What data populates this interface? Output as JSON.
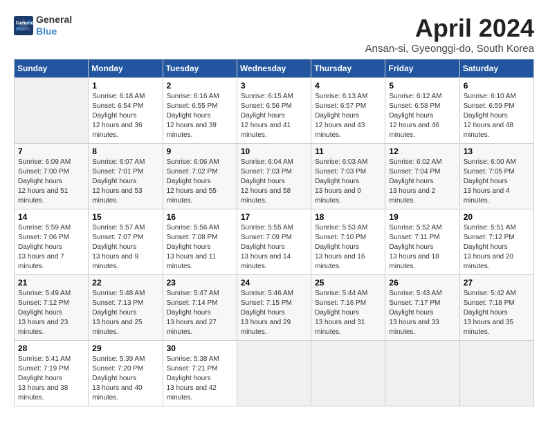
{
  "header": {
    "logo_line1": "General",
    "logo_line2": "Blue",
    "title": "April 2024",
    "subtitle": "Ansan-si, Gyeonggi-do, South Korea"
  },
  "weekdays": [
    "Sunday",
    "Monday",
    "Tuesday",
    "Wednesday",
    "Thursday",
    "Friday",
    "Saturday"
  ],
  "weeks": [
    [
      {
        "day": "",
        "empty": true
      },
      {
        "day": "1",
        "sunrise": "6:18 AM",
        "sunset": "6:54 PM",
        "daylight": "12 hours and 36 minutes."
      },
      {
        "day": "2",
        "sunrise": "6:16 AM",
        "sunset": "6:55 PM",
        "daylight": "12 hours and 39 minutes."
      },
      {
        "day": "3",
        "sunrise": "6:15 AM",
        "sunset": "6:56 PM",
        "daylight": "12 hours and 41 minutes."
      },
      {
        "day": "4",
        "sunrise": "6:13 AM",
        "sunset": "6:57 PM",
        "daylight": "12 hours and 43 minutes."
      },
      {
        "day": "5",
        "sunrise": "6:12 AM",
        "sunset": "6:58 PM",
        "daylight": "12 hours and 46 minutes."
      },
      {
        "day": "6",
        "sunrise": "6:10 AM",
        "sunset": "6:59 PM",
        "daylight": "12 hours and 48 minutes."
      }
    ],
    [
      {
        "day": "7",
        "sunrise": "6:09 AM",
        "sunset": "7:00 PM",
        "daylight": "12 hours and 51 minutes."
      },
      {
        "day": "8",
        "sunrise": "6:07 AM",
        "sunset": "7:01 PM",
        "daylight": "12 hours and 53 minutes."
      },
      {
        "day": "9",
        "sunrise": "6:06 AM",
        "sunset": "7:02 PM",
        "daylight": "12 hours and 55 minutes."
      },
      {
        "day": "10",
        "sunrise": "6:04 AM",
        "sunset": "7:03 PM",
        "daylight": "12 hours and 58 minutes."
      },
      {
        "day": "11",
        "sunrise": "6:03 AM",
        "sunset": "7:03 PM",
        "daylight": "13 hours and 0 minutes."
      },
      {
        "day": "12",
        "sunrise": "6:02 AM",
        "sunset": "7:04 PM",
        "daylight": "13 hours and 2 minutes."
      },
      {
        "day": "13",
        "sunrise": "6:00 AM",
        "sunset": "7:05 PM",
        "daylight": "13 hours and 4 minutes."
      }
    ],
    [
      {
        "day": "14",
        "sunrise": "5:59 AM",
        "sunset": "7:06 PM",
        "daylight": "13 hours and 7 minutes."
      },
      {
        "day": "15",
        "sunrise": "5:57 AM",
        "sunset": "7:07 PM",
        "daylight": "13 hours and 9 minutes."
      },
      {
        "day": "16",
        "sunrise": "5:56 AM",
        "sunset": "7:08 PM",
        "daylight": "13 hours and 11 minutes."
      },
      {
        "day": "17",
        "sunrise": "5:55 AM",
        "sunset": "7:09 PM",
        "daylight": "13 hours and 14 minutes."
      },
      {
        "day": "18",
        "sunrise": "5:53 AM",
        "sunset": "7:10 PM",
        "daylight": "13 hours and 16 minutes."
      },
      {
        "day": "19",
        "sunrise": "5:52 AM",
        "sunset": "7:11 PM",
        "daylight": "13 hours and 18 minutes."
      },
      {
        "day": "20",
        "sunrise": "5:51 AM",
        "sunset": "7:12 PM",
        "daylight": "13 hours and 20 minutes."
      }
    ],
    [
      {
        "day": "21",
        "sunrise": "5:49 AM",
        "sunset": "7:12 PM",
        "daylight": "13 hours and 23 minutes."
      },
      {
        "day": "22",
        "sunrise": "5:48 AM",
        "sunset": "7:13 PM",
        "daylight": "13 hours and 25 minutes."
      },
      {
        "day": "23",
        "sunrise": "5:47 AM",
        "sunset": "7:14 PM",
        "daylight": "13 hours and 27 minutes."
      },
      {
        "day": "24",
        "sunrise": "5:46 AM",
        "sunset": "7:15 PM",
        "daylight": "13 hours and 29 minutes."
      },
      {
        "day": "25",
        "sunrise": "5:44 AM",
        "sunset": "7:16 PM",
        "daylight": "13 hours and 31 minutes."
      },
      {
        "day": "26",
        "sunrise": "5:43 AM",
        "sunset": "7:17 PM",
        "daylight": "13 hours and 33 minutes."
      },
      {
        "day": "27",
        "sunrise": "5:42 AM",
        "sunset": "7:18 PM",
        "daylight": "13 hours and 35 minutes."
      }
    ],
    [
      {
        "day": "28",
        "sunrise": "5:41 AM",
        "sunset": "7:19 PM",
        "daylight": "13 hours and 38 minutes."
      },
      {
        "day": "29",
        "sunrise": "5:39 AM",
        "sunset": "7:20 PM",
        "daylight": "13 hours and 40 minutes."
      },
      {
        "day": "30",
        "sunrise": "5:38 AM",
        "sunset": "7:21 PM",
        "daylight": "13 hours and 42 minutes."
      },
      {
        "day": "",
        "empty": true
      },
      {
        "day": "",
        "empty": true
      },
      {
        "day": "",
        "empty": true
      },
      {
        "day": "",
        "empty": true
      }
    ]
  ],
  "labels": {
    "sunrise": "Sunrise:",
    "sunset": "Sunset:",
    "daylight": "Daylight hours"
  }
}
